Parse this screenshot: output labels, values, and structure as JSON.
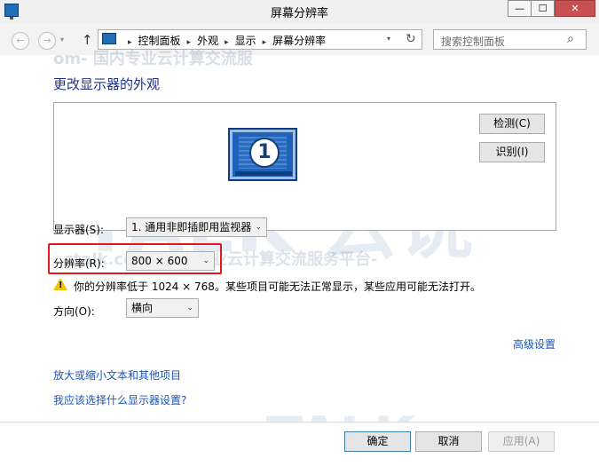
{
  "window": {
    "title": "屏幕分辨率",
    "minimize_glyph": "—",
    "maximize_glyph": "☐",
    "close_glyph": "✕"
  },
  "nav": {
    "back_glyph": "←",
    "forward_glyph": "→",
    "dropdown_glyph": "▾",
    "up_glyph": "↑",
    "breadcrumbs": [
      "控制面板",
      "外观",
      "显示",
      "屏幕分辨率"
    ],
    "crumb_separator": "▸",
    "refresh_glyph": "↻",
    "search_placeholder": "搜索控制面板",
    "search_glyph": "⌕"
  },
  "main": {
    "heading": "更改显示器的外观",
    "monitor_number": "1",
    "detect_button": "检测(C)",
    "identify_button": "识别(I)",
    "display_label": "显示器(S):",
    "display_value": "1. 通用非即插即用监视器",
    "resolution_label": "分辨率(R):",
    "resolution_value": "800 × 600",
    "warning_glyph": "!",
    "warning_text": "你的分辨率低于 1024 × 768。某些项目可能无法正常显示，某些应用可能无法打开。",
    "orientation_label": "方向(O):",
    "orientation_value": "横向",
    "chevron_glyph": "⌄",
    "advanced_link": "高级设置",
    "text_size_link": "放大或缩小文本和其他项目",
    "which_settings_link": "我应该选择什么显示器设置?"
  },
  "footer": {
    "ok_button": "确定",
    "cancel_button": "取消",
    "apply_button": "应用(A)"
  },
  "watermark": {
    "top_text": "om- 国内专业云计算交流服",
    "big_text": "TALK 云说",
    "line_text": "stalk.com- 国内专业云计算交流服务平台-",
    "foot_text": "TALK"
  },
  "colors": {
    "link": "#1a56b8",
    "heading": "#1e3287",
    "highlight": "#e1191c",
    "warning": "#f1c40f"
  }
}
